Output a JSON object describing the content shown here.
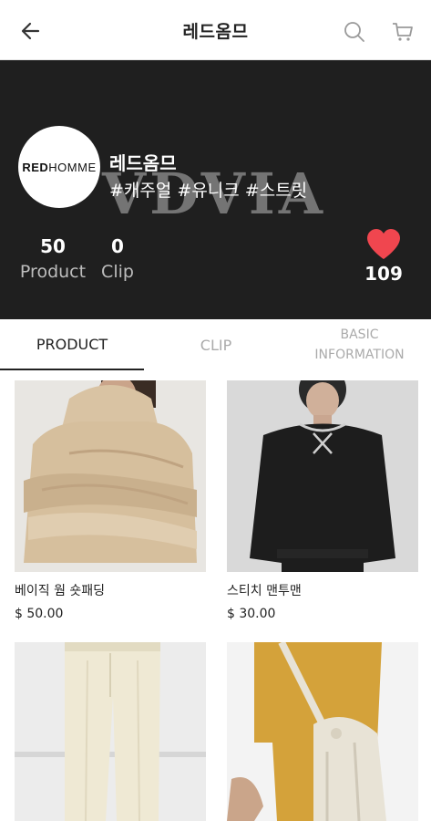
{
  "appbar": {
    "title": "레드옴므",
    "back_icon": "arrow-left-icon",
    "search_icon": "search-icon",
    "cart_icon": "cart-icon"
  },
  "banner": {
    "background": "#1f1f1f",
    "watermark": "VDVIA",
    "logo": {
      "bold": "RED",
      "light": "HOMME"
    },
    "store_name": "레드옴므",
    "tags": "#캐주얼 #유니크 #스트릿",
    "stats": {
      "product_count": "50",
      "product_label": "Product",
      "clip_count": "0",
      "clip_label": "Clip"
    },
    "likes": {
      "count": "109",
      "icon": "heart-icon",
      "color": "#f0464f"
    }
  },
  "tabs": {
    "product": "PRODUCT",
    "clip": "CLIP",
    "basic_line1": "BASIC",
    "basic_line2": "INFORMATION",
    "active": "product"
  },
  "products": [
    {
      "name": "베이직 웜 숏패딩",
      "price": "$ 50.00"
    },
    {
      "name": "스티치 맨투맨",
      "price": "$ 30.00"
    },
    {
      "name": "",
      "price": ""
    },
    {
      "name": "",
      "price": ""
    }
  ]
}
